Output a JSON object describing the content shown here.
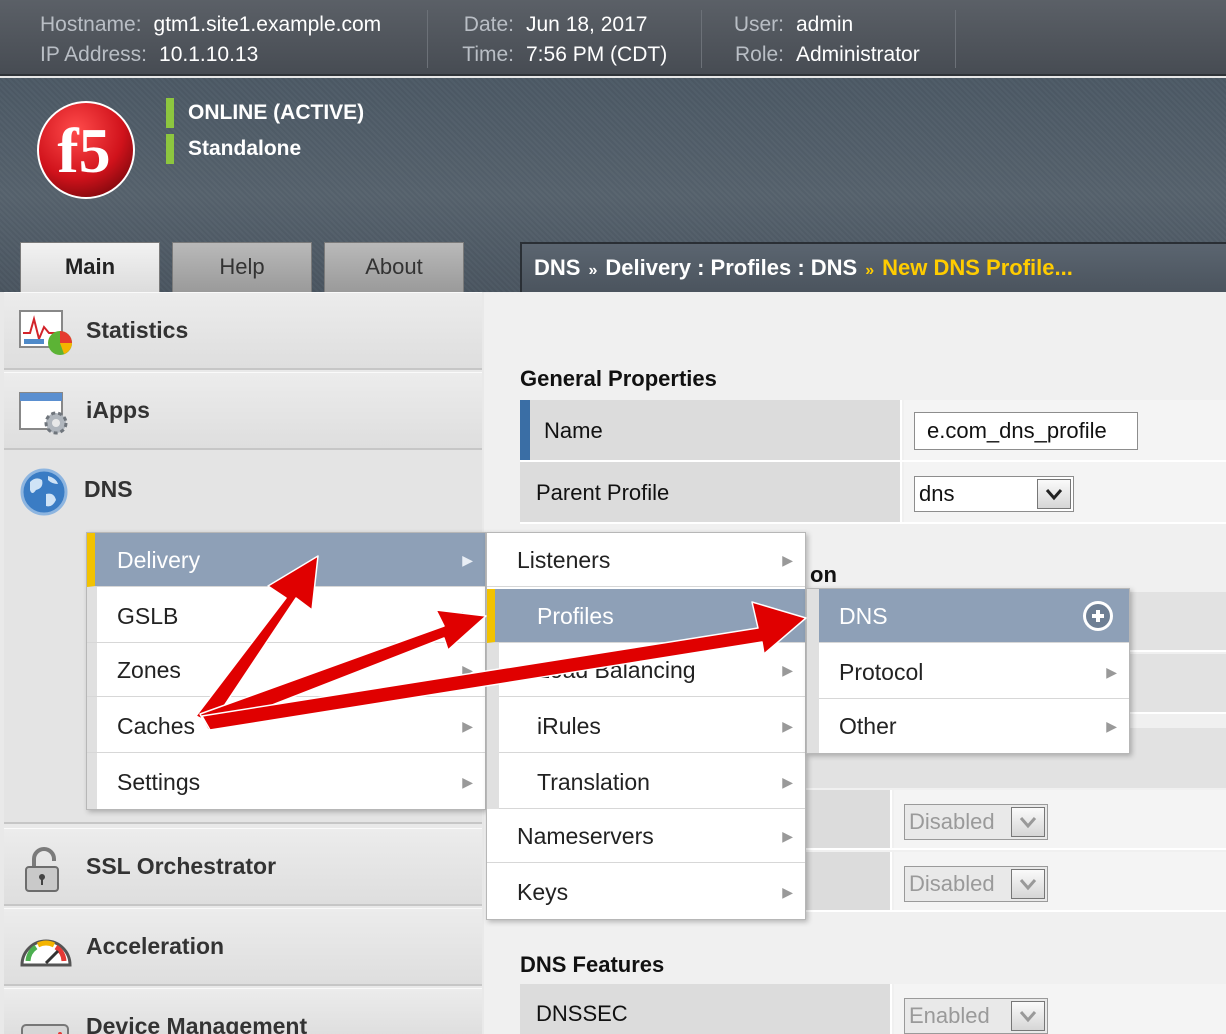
{
  "header": {
    "hostname_label": "Hostname:",
    "hostname": "gtm1.site1.example.com",
    "ip_label": "IP Address:",
    "ip": "10.1.10.13",
    "date_label": "Date:",
    "date": "Jun 18, 2017",
    "time_label": "Time:",
    "time": "7:56 PM (CDT)",
    "user_label": "User:",
    "user": "admin",
    "role_label": "Role:",
    "role": "Administrator"
  },
  "banner": {
    "logo_text": "f5",
    "status_online": "ONLINE (ACTIVE)",
    "status_mode": "Standalone",
    "status_color": "#8dc63f"
  },
  "tabs": [
    {
      "label": "Main",
      "active": true
    },
    {
      "label": "Help",
      "active": false
    },
    {
      "label": "About",
      "active": false
    }
  ],
  "breadcrumb": {
    "part1": "DNS",
    "separator": "»",
    "part2": "Delivery : Profiles : DNS",
    "current": "New DNS Profile..."
  },
  "sidebar": {
    "sections": [
      {
        "label": "Statistics",
        "icon": "statistics-chart-icon"
      },
      {
        "label": "iApps",
        "icon": "iapps-window-gear-icon"
      },
      {
        "label": "DNS",
        "icon": "globe-icon"
      },
      {
        "label": "SSL Orchestrator",
        "icon": "padlock-icon"
      },
      {
        "label": "Acceleration",
        "icon": "speedometer-icon"
      },
      {
        "label": "Device Management",
        "icon": "server-device-icon"
      }
    ]
  },
  "menus": {
    "dns_submenu": [
      {
        "label": "Delivery",
        "selected": true
      },
      {
        "label": "GSLB",
        "selected": false
      },
      {
        "label": "Zones",
        "selected": false
      },
      {
        "label": "Caches",
        "selected": false
      },
      {
        "label": "Settings",
        "selected": false
      }
    ],
    "delivery_submenu": [
      {
        "label": "Listeners",
        "selected": false
      },
      {
        "label": "Profiles",
        "selected": true
      },
      {
        "label": "Load Balancing",
        "selected": false
      },
      {
        "label": "iRules",
        "selected": false
      },
      {
        "label": "Translation",
        "selected": false
      },
      {
        "label": "Nameservers",
        "selected": false
      },
      {
        "label": "Keys",
        "selected": false
      }
    ],
    "profiles_submenu": [
      {
        "label": "DNS",
        "selected": true,
        "add_icon": "plus-circle-icon"
      },
      {
        "label": "Protocol",
        "selected": false
      },
      {
        "label": "Other",
        "selected": false
      }
    ],
    "highlight_color": "#8ea0b7",
    "selected_marker_color": "#f2c200"
  },
  "content": {
    "general_title": "General Properties",
    "name_label": "Name",
    "name_value": "e.com_dns_profile",
    "parent_label": "Parent Profile",
    "parent_value": "dns",
    "partial_heading": "on",
    "disabled_1": "Disabled",
    "disabled_2": "Disabled",
    "dns_features_title": "DNS Features",
    "dnssec_label": "DNSSEC",
    "dnssec_value": "Enabled"
  },
  "annotation": {
    "arrow_color": "#ff0000"
  }
}
